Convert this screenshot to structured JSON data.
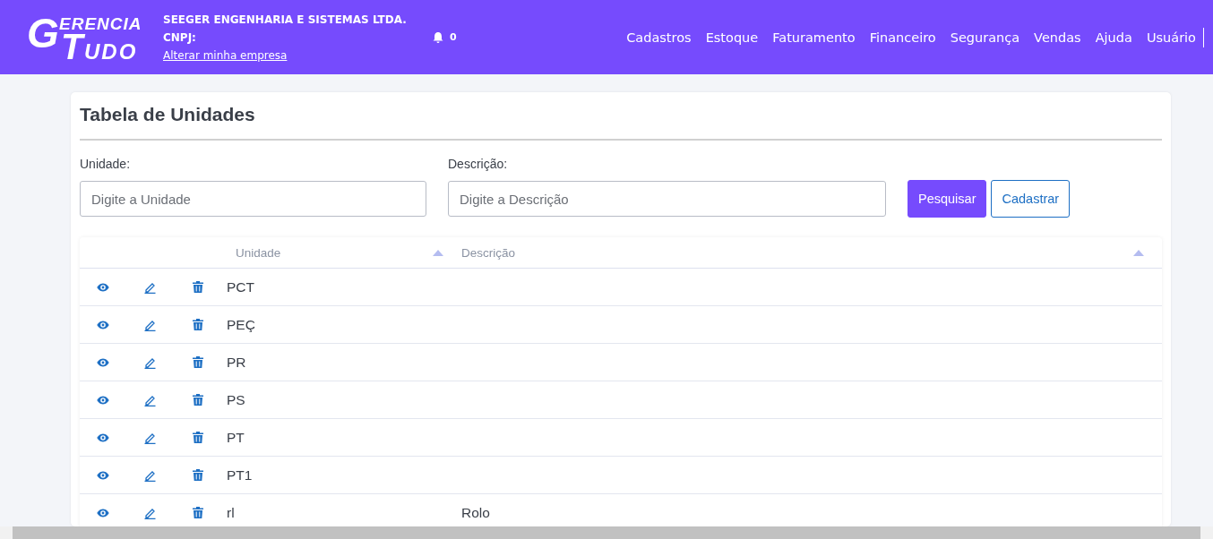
{
  "header": {
    "logo_top": "ERENCIA",
    "logo_letter_g": "G",
    "logo_letter_t": "T",
    "logo_bottom": "UDO",
    "company": "SEEGER ENGENHARIA E SISTEMAS LTDA.",
    "cnpj_label": "CNPJ:",
    "change_company_link": "Alterar minha empresa",
    "notifications_count": "0"
  },
  "nav": [
    "Cadastros",
    "Estoque",
    "Faturamento",
    "Financeiro",
    "Segurança",
    "Vendas",
    "Ajuda",
    "Usuário"
  ],
  "page": {
    "title": "Tabela de Unidades"
  },
  "filters": [
    {
      "label": "Unidade:",
      "placeholder": "Digite a Unidade"
    },
    {
      "label": "Descrição:",
      "placeholder": "Digite a Descrição"
    }
  ],
  "buttons": [
    {
      "label": "Pesquisar",
      "kind": "primary"
    },
    {
      "label": "Cadastrar",
      "kind": "outline"
    }
  ],
  "table": {
    "columns": [
      "Unidade",
      "Descrição"
    ],
    "rows": [
      {
        "unidade": "PCT",
        "descricao": ""
      },
      {
        "unidade": "PEÇ",
        "descricao": ""
      },
      {
        "unidade": "PR",
        "descricao": ""
      },
      {
        "unidade": "PS",
        "descricao": ""
      },
      {
        "unidade": "PT",
        "descricao": ""
      },
      {
        "unidade": "PT1",
        "descricao": ""
      },
      {
        "unidade": "rl",
        "descricao": "Rolo"
      }
    ]
  }
}
